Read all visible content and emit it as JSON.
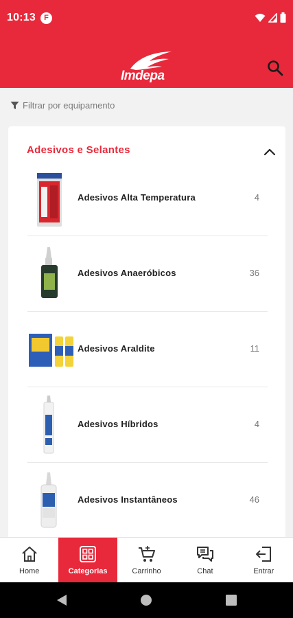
{
  "status_bar": {
    "time": "10:13",
    "app_badge": "F",
    "icons": [
      "wifi-icon",
      "signal-icon",
      "battery-icon"
    ]
  },
  "header": {
    "brand": "Imdepa",
    "search_icon": "search-icon",
    "background": "#e8293b"
  },
  "filter": {
    "label": "Filtrar por equipamento",
    "icon": "filter-icon"
  },
  "category": {
    "title": "Adesivos e Selantes",
    "collapse_icon": "chevron-up-icon",
    "items": [
      {
        "name": "Adesivos Alta Temperatura",
        "count": "4"
      },
      {
        "name": "Adesivos Anaeróbicos",
        "count": "36"
      },
      {
        "name": "Adesivos Araldite",
        "count": "11"
      },
      {
        "name": "Adesivos Híbridos",
        "count": "4"
      },
      {
        "name": "Adesivos Instantâneos",
        "count": "46"
      }
    ]
  },
  "bottom_nav": [
    {
      "label": "Home",
      "icon": "home-icon",
      "active": false
    },
    {
      "label": "Categorias",
      "icon": "categories-icon",
      "active": true
    },
    {
      "label": "Carrinho",
      "icon": "cart-icon",
      "active": false
    },
    {
      "label": "Chat",
      "icon": "chat-icon",
      "active": false
    },
    {
      "label": "Entrar",
      "icon": "login-icon",
      "active": false
    }
  ],
  "colors": {
    "accent": "#e8293b",
    "text": "#222222",
    "muted": "#777777"
  }
}
